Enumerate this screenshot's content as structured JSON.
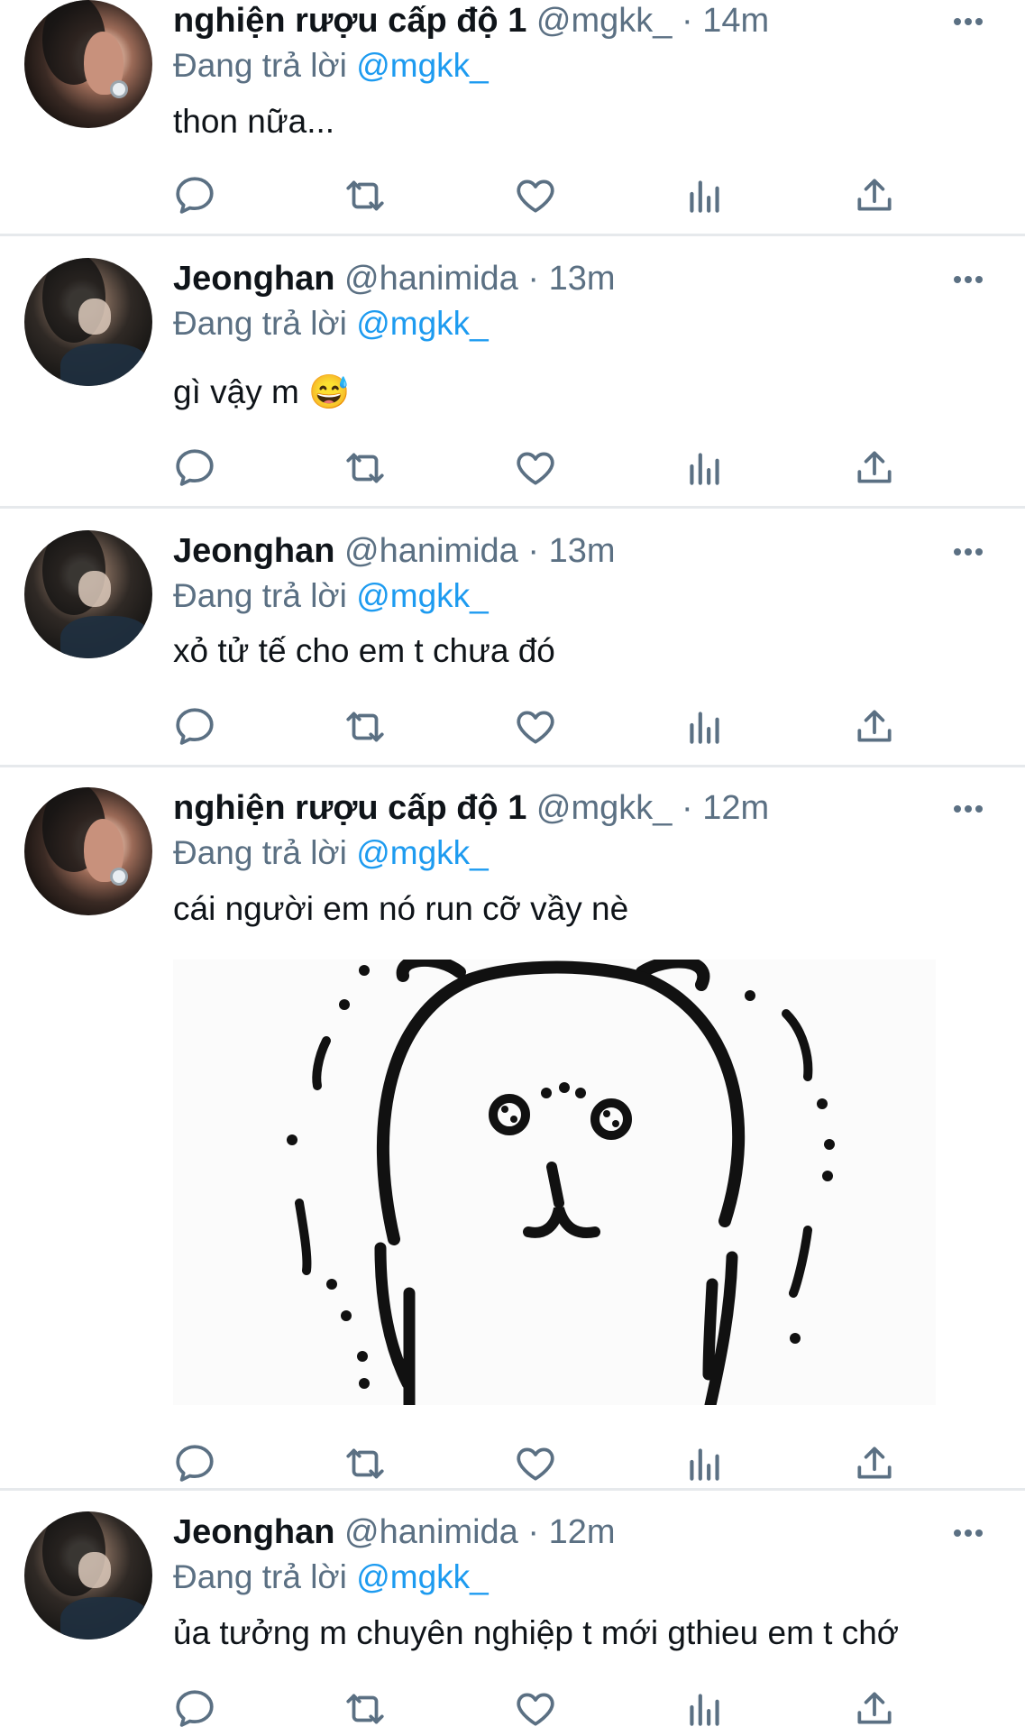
{
  "tweets": [
    {
      "name": "nghiện rượu cấp độ 1",
      "handle": "@mgkk_",
      "time": "14m",
      "replying_prefix": "Đang trả lời",
      "replying_to": "@mgkk_",
      "text": "thon nữa...",
      "avatar": "ear-piercing-avatar"
    },
    {
      "name": "Jeonghan",
      "handle": "@hanimida",
      "time": "13m",
      "replying_prefix": "Đang trả lời",
      "replying_to": "@mgkk_",
      "text": "gì vậy m 😅",
      "avatar": "person-avatar"
    },
    {
      "name": "Jeonghan",
      "handle": "@hanimida",
      "time": "13m",
      "replying_prefix": "Đang trả lời",
      "replying_to": "@mgkk_",
      "text": "xỏ tử tế cho em t chưa đó",
      "avatar": "person-avatar"
    },
    {
      "name": "nghiện rượu cấp độ 1",
      "handle": "@mgkk_",
      "time": "12m",
      "replying_prefix": "Đang trả lời",
      "replying_to": "@mgkk_",
      "text": "cái người em nó run cỡ vầy nè",
      "avatar": "ear-piercing-avatar",
      "media": "trembling-cartoon-bear-image"
    },
    {
      "name": "Jeonghan",
      "handle": "@hanimida",
      "time": "12m",
      "replying_prefix": "Đang trả lời",
      "replying_to": "@mgkk_",
      "text": "ủa tưởng m chuyên nghiệp t mới gthieu em t chớ",
      "avatar": "person-avatar"
    }
  ],
  "separator": "·",
  "action_icons": [
    "reply-icon",
    "retweet-icon",
    "like-icon",
    "analytics-icon",
    "share-icon"
  ],
  "colors": {
    "text": "#0f1419",
    "secondary": "#5b7083",
    "mention": "#1d9bf0",
    "divider": "#e6e9ec"
  }
}
